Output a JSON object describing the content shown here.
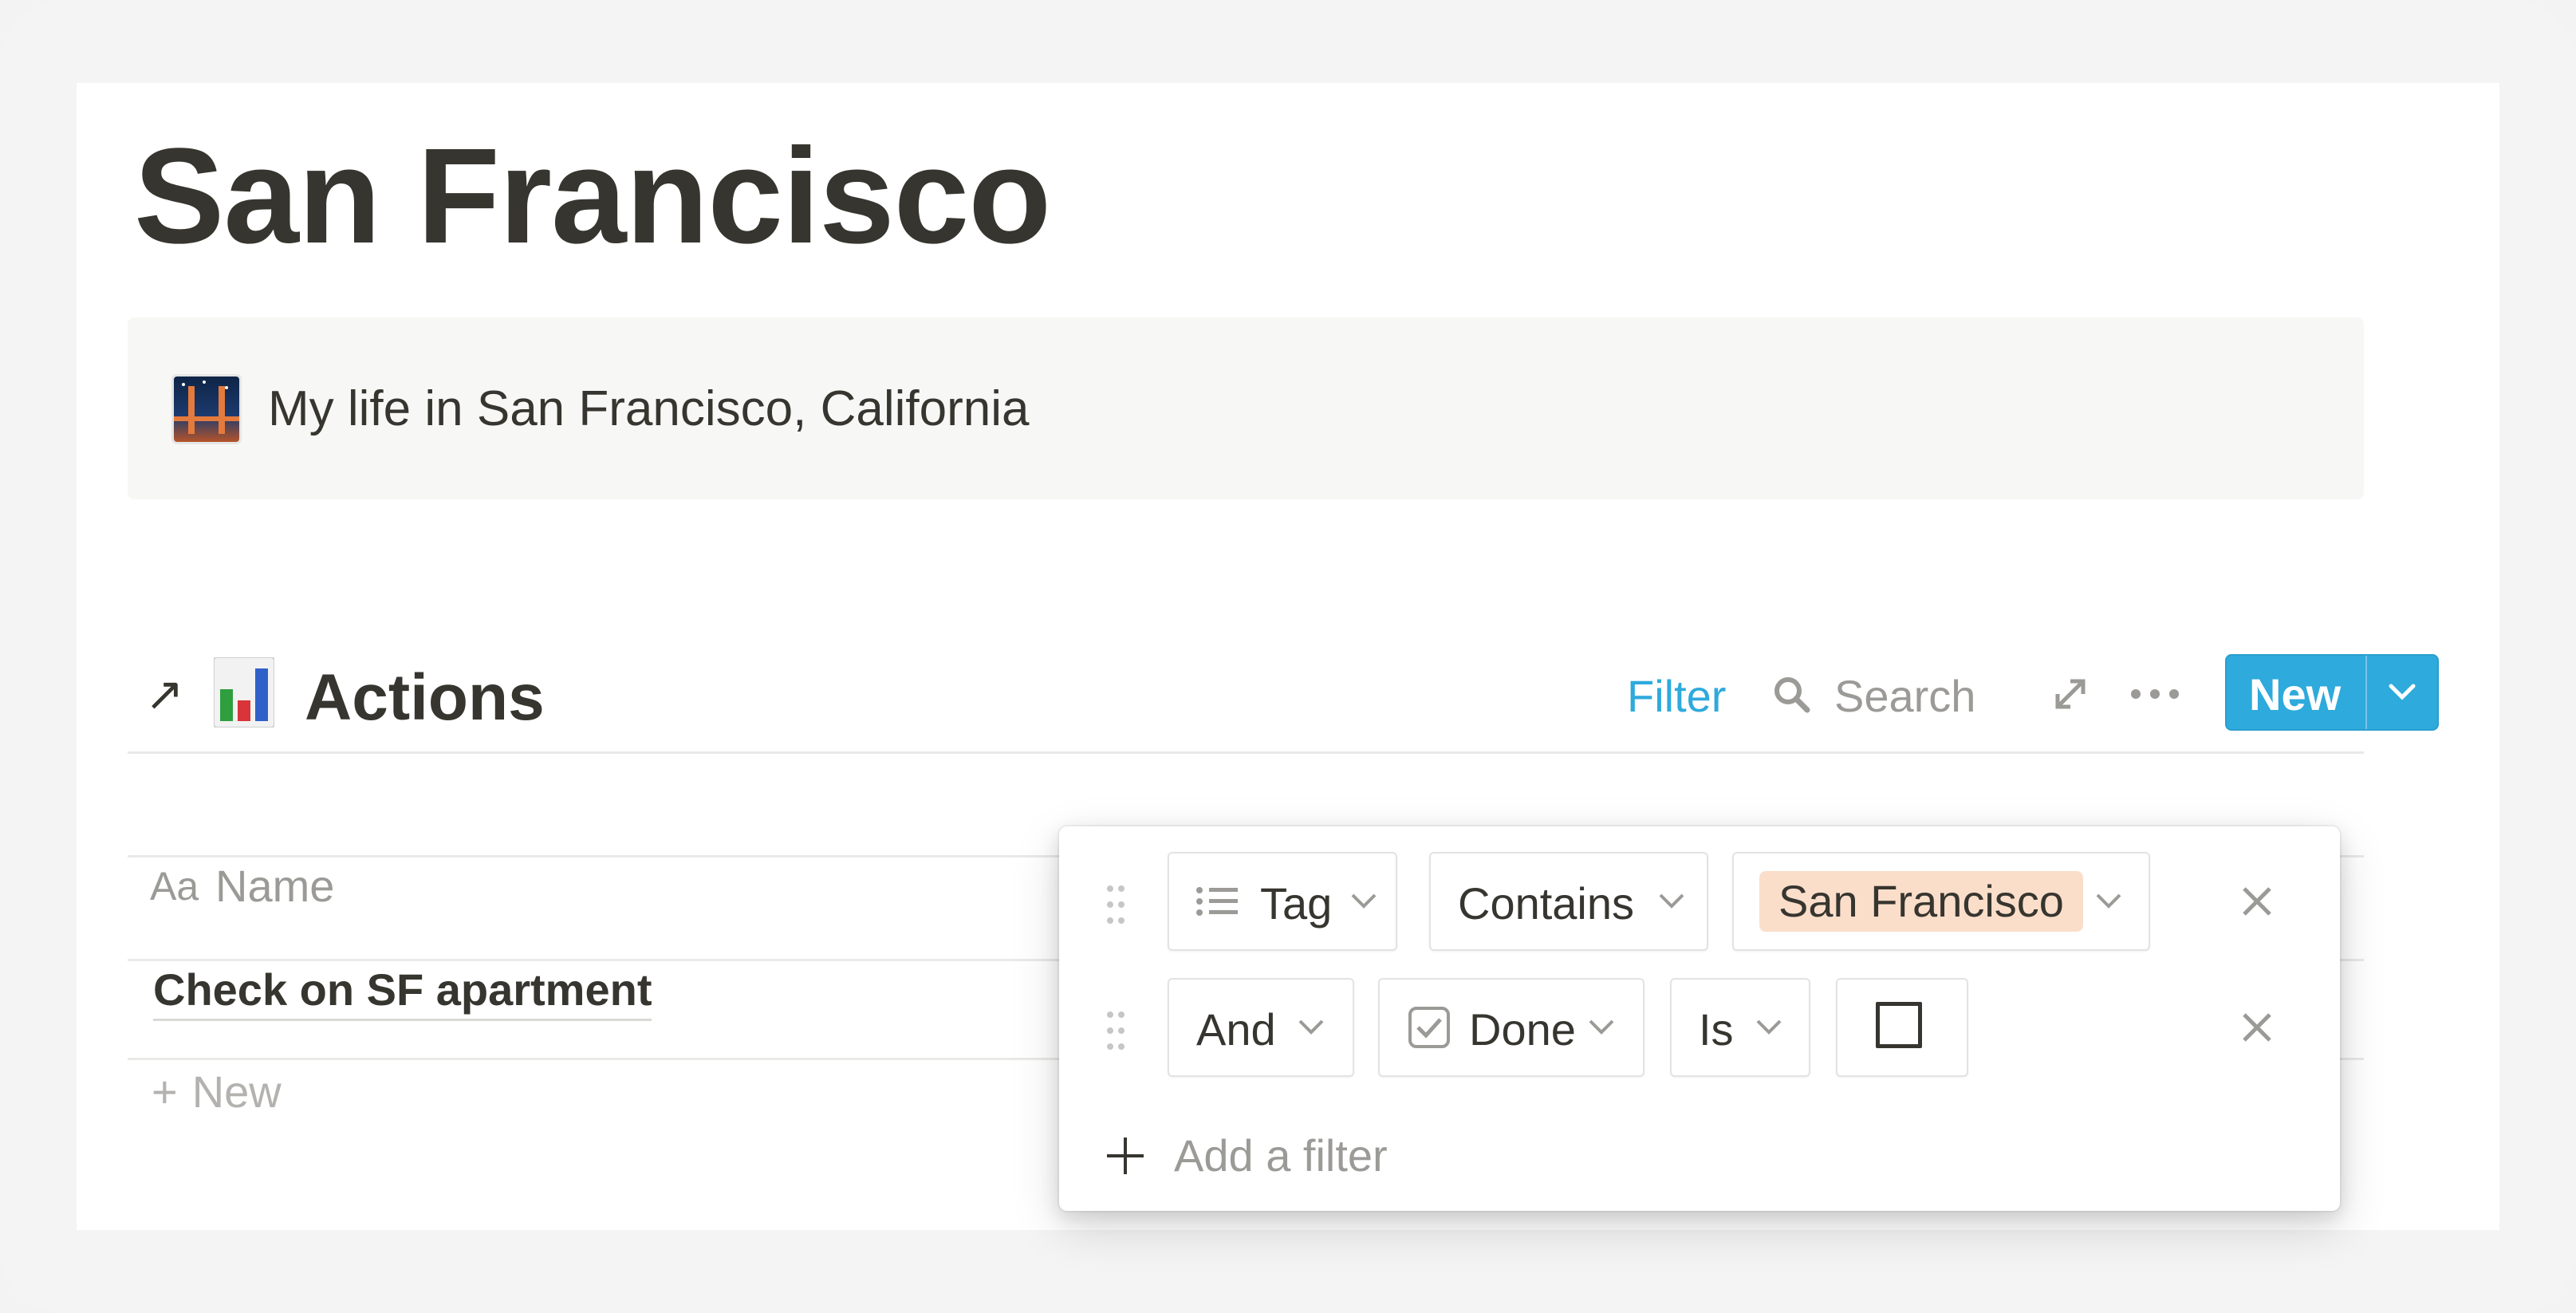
{
  "page": {
    "title": "San Francisco"
  },
  "callout": {
    "icon": "golden-gate-bridge-emoji",
    "text": "My life in San Francisco, California"
  },
  "database": {
    "link_icon": "arrow-up-right-icon",
    "icon": "bar-chart-emoji",
    "title": "Actions",
    "toolbar": {
      "filter_label": "Filter",
      "search_label": "Search",
      "new_label": "New"
    },
    "columns": [
      {
        "icon": "Aa",
        "label": "Name"
      }
    ],
    "rows": [
      {
        "name": "Check on SF apartment"
      }
    ],
    "new_row_label": "New"
  },
  "filter_popover": {
    "rules": [
      {
        "property_icon": "list-icon",
        "property": "Tag",
        "operator": "Contains",
        "value": "San Francisco",
        "value_color": "#fadeca"
      },
      {
        "conjunction": "And",
        "property_icon": "checkbox-icon",
        "property": "Done",
        "operator": "Is",
        "value_checked": false
      }
    ],
    "add_filter_label": "Add a filter"
  },
  "colors": {
    "accent": "#2eaadc",
    "text": "#37352f",
    "muted": "#9b9a97"
  }
}
